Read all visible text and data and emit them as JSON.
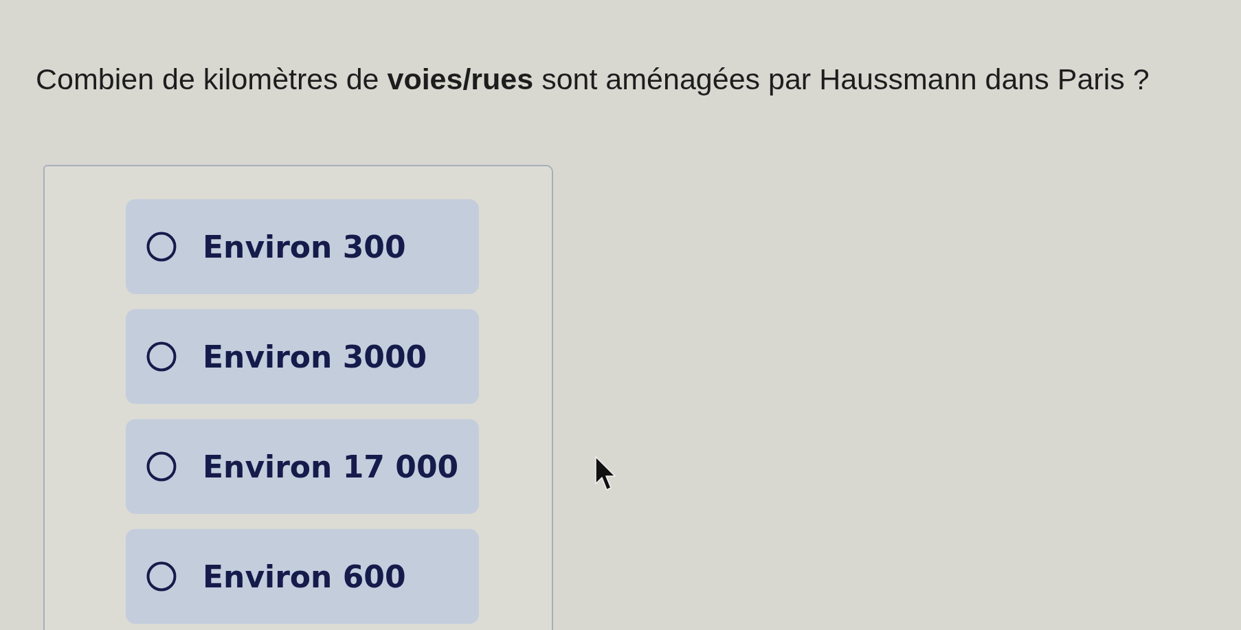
{
  "question": {
    "text": "Combien de kilomètres de **voies/rues** sont aménagées par Haussmann dans Paris ?"
  },
  "options": [
    {
      "label": "Environ 300",
      "selected": false
    },
    {
      "label": "Environ 3000",
      "selected": false
    },
    {
      "label": "Environ 17 000",
      "selected": false
    },
    {
      "label": "Environ 600",
      "selected": false
    }
  ]
}
